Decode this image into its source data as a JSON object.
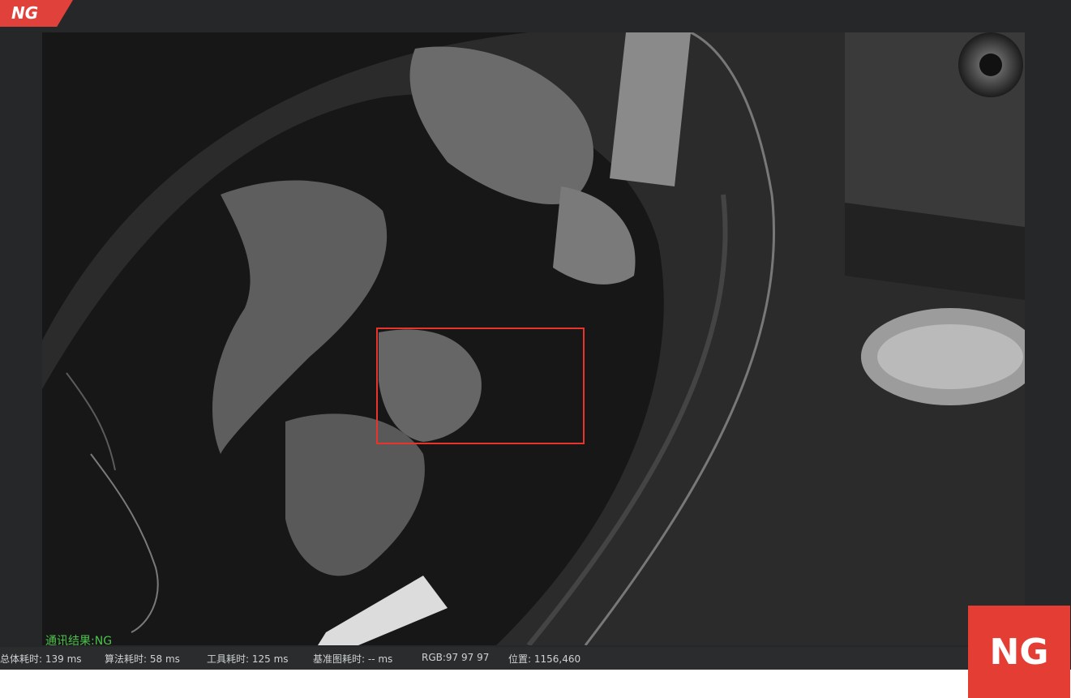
{
  "header": {
    "result_tag": "NG"
  },
  "viewer": {
    "comm_result": "通讯结果:NG",
    "status": {
      "total_time": "总体耗时: 139 ms",
      "algo_time": "算法耗时: 58 ms",
      "tool_time": "工具耗时: 125 ms",
      "base_time": "基准图耗时: -- ms",
      "rgb": "RGB:97 97 97",
      "position": "位置: 1156,460"
    }
  },
  "result_badge": {
    "label": "NG"
  },
  "colors": {
    "ng_red": "#e43d33",
    "roi_red": "#e8342a",
    "comm_green": "#4cc34c"
  }
}
